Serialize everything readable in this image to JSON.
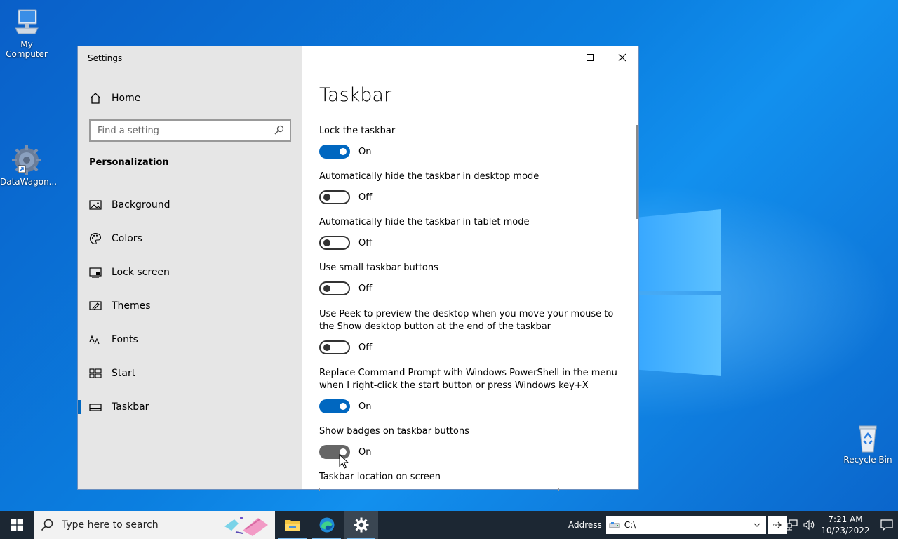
{
  "desktop": {
    "icons": [
      {
        "label": "My Computer"
      },
      {
        "label": "DataWagon..."
      },
      {
        "label": "Recycle Bin"
      }
    ]
  },
  "window": {
    "title": "Settings",
    "sidebar": {
      "home_label": "Home",
      "search_placeholder": "Find a setting",
      "section": "Personalization",
      "items": [
        {
          "label": "Background",
          "icon": "picture-icon"
        },
        {
          "label": "Colors",
          "icon": "palette-icon"
        },
        {
          "label": "Lock screen",
          "icon": "lock-screen-icon"
        },
        {
          "label": "Themes",
          "icon": "themes-icon"
        },
        {
          "label": "Fonts",
          "icon": "fonts-icon"
        },
        {
          "label": "Start",
          "icon": "start-icon"
        },
        {
          "label": "Taskbar",
          "icon": "taskbar-icon",
          "active": true
        }
      ]
    },
    "main": {
      "title": "Taskbar",
      "settings": [
        {
          "label": "Lock the taskbar",
          "state": "On"
        },
        {
          "label": "Automatically hide the taskbar in desktop mode",
          "state": "Off"
        },
        {
          "label": "Automatically hide the taskbar in tablet mode",
          "state": "Off"
        },
        {
          "label": "Use small taskbar buttons",
          "state": "Off"
        },
        {
          "label": "Use Peek to preview the desktop when you move your mouse to the Show desktop button at the end of the taskbar",
          "state": "Off"
        },
        {
          "label": "Replace Command Prompt with Windows PowerShell in the menu when I right-click the start button or press Windows key+X",
          "state": "On"
        },
        {
          "label": "Show badges on taskbar buttons",
          "state": "On"
        }
      ],
      "location_label": "Taskbar location on screen"
    }
  },
  "taskbar": {
    "search_placeholder": "Type here to search",
    "address_label": "Address",
    "address_value": "C:\\",
    "clock_time": "7:21 AM",
    "clock_date": "10/23/2022"
  },
  "colors": {
    "accent": "#0067c0",
    "sidebar_bg": "#e6e6e6",
    "taskbar_bg": "#1c2733"
  }
}
